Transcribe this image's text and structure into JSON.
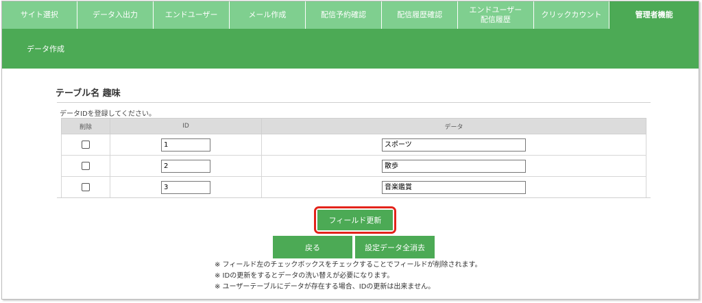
{
  "tabs": [
    {
      "label": "サイト選択",
      "width": 110
    },
    {
      "label": "データ入出力",
      "width": 112
    },
    {
      "label": "エンドユーザー",
      "width": 111
    },
    {
      "label": "メール作成",
      "width": 111
    },
    {
      "label": "配信予約確認",
      "width": 112
    },
    {
      "label": "配信履歴確認",
      "width": 111
    },
    {
      "label": "エンドユーザー\n配信履歴",
      "width": 111
    },
    {
      "label": "クリックカウント",
      "width": 111
    },
    {
      "label": "管理者機能",
      "width": 110,
      "active": true
    }
  ],
  "banner": {
    "title": "データ作成"
  },
  "table_name": "テーブル名 趣味",
  "instruction": "データIDを登録してください。",
  "table": {
    "headers": {
      "delete": "削除",
      "id": "ID",
      "data": "データ"
    },
    "rows": [
      {
        "id": "1",
        "data": "スポーツ"
      },
      {
        "id": "2",
        "data": "散歩"
      },
      {
        "id": "3",
        "data": "音楽鑑賞"
      }
    ]
  },
  "buttons": {
    "field_update": "フィールド更新",
    "back": "戻る",
    "clear_all": "設定データ全消去"
  },
  "notes": [
    "※ フィールド左のチェックボックスをチェックすることでフィールドが削除されます。",
    "※ IDの更新をするとデータの洗い替えが必要になります。",
    "※ ユーザーテーブルにデータが存在する場合、IDの更新は出来ません。"
  ],
  "colors": {
    "accent": "#4caa55",
    "tab": "#7fcf8f",
    "highlight": "#e2231a"
  }
}
